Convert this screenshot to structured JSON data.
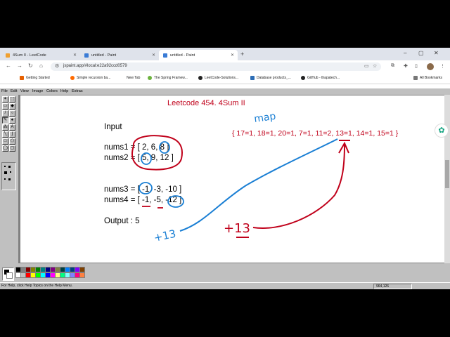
{
  "tabs": [
    {
      "label": "4Sum II - LeetCode",
      "icon": "leetcode-icon",
      "color": "#f0a030"
    },
    {
      "label": "untitled - Paint",
      "icon": "paint-icon",
      "color": "#3a7bd5"
    },
    {
      "label": "untitled - Paint",
      "icon": "paint-icon",
      "color": "#3a7bd5"
    }
  ],
  "address": {
    "url": "jspaint.app/#local:e22a92ccd0579"
  },
  "bookmarks": [
    {
      "label": "Getting Started",
      "icon": "firefox-icon",
      "color": "#e66000"
    },
    {
      "label": "Simple recursion ba...",
      "icon": "dot-icon",
      "color": "#ff6a00"
    },
    {
      "label": "New Tab",
      "icon": "page-icon",
      "color": "#ffffff"
    },
    {
      "label": "The Spring Framew...",
      "icon": "spring-icon",
      "color": "#6db33f"
    },
    {
      "label": "LeetCode-Solutions...",
      "icon": "github-icon",
      "color": "#222222"
    },
    {
      "label": "Database products_...",
      "icon": "db-icon",
      "color": "#2d6db5"
    },
    {
      "label": "GitHub - thapatech...",
      "icon": "github-icon",
      "color": "#222222"
    },
    {
      "label": "All Bookmarks",
      "icon": "folder-icon",
      "color": "#777777"
    }
  ],
  "paint_menu": [
    "File",
    "Edit",
    "View",
    "Image",
    "Colors",
    "Help",
    "Extras"
  ],
  "canvas": {
    "title": "Leetcode 454. 4Sum II",
    "input_label": "Input",
    "nums1": "nums1 = [ 2, 6, 8 ]",
    "nums2": "nums2 = [ 5, 9, 12 ]",
    "nums3": "nums3 = [ -1, -3, -10 ]",
    "nums4": "nums4 = [ -1, -5, -12 ]",
    "output": "Output : 5",
    "map_label": "map",
    "map_contents": "{ 17=1, 18=1, 20=1, 7=1, 11=2, 13=1, 14=1, 15=1 }",
    "note_blue": "+13",
    "note_red": "+13"
  },
  "status": {
    "help_text": "For Help, click Help Topics on the Help Menu.",
    "coords": "964,126"
  },
  "palette": [
    "#000000",
    "#808080",
    "#800000",
    "#808000",
    "#008000",
    "#008080",
    "#000080",
    "#800080",
    "#808040",
    "#004040",
    "#0080ff",
    "#004080",
    "#8000ff",
    "#804000",
    "#ffffff",
    "#c0c0c0",
    "#ff0000",
    "#ffff00",
    "#00ff00",
    "#00ffff",
    "#0000ff",
    "#ff00ff",
    "#ffff80",
    "#00ff80",
    "#80ffff",
    "#8080ff",
    "#ff0080",
    "#ff8040"
  ],
  "colors": {
    "ink_red": "#c0001a",
    "ink_blue": "#1a7fd4"
  }
}
